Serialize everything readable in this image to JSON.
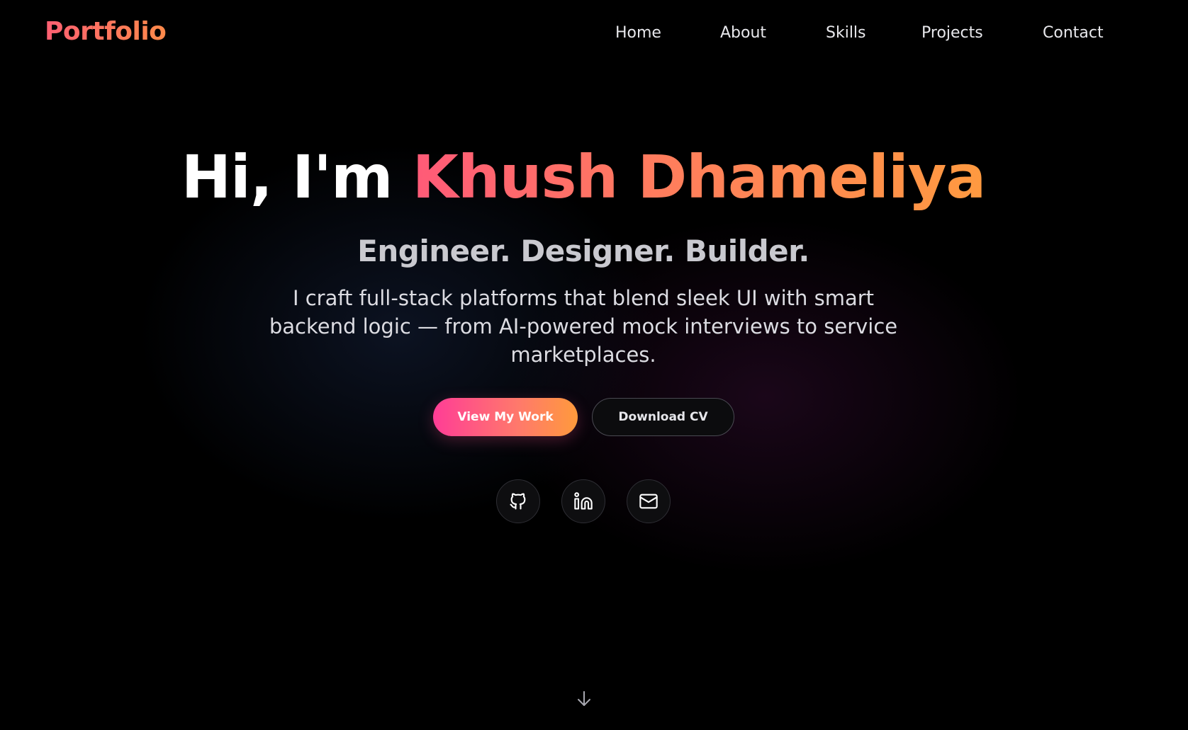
{
  "header": {
    "logo": "Portfolio",
    "nav": [
      "Home",
      "About",
      "Skills",
      "Projects",
      "Contact"
    ]
  },
  "hero": {
    "greeting": "Hi, I'm",
    "name": "Khush Dhameliya",
    "subtitle": "Engineer. Designer. Builder.",
    "description": "I craft full-stack platforms that blend sleek UI with smart backend logic — from AI-powered mock interviews to service marketplaces.",
    "primary_button": "View My Work",
    "secondary_button": "Download CV"
  },
  "social": {
    "icons": [
      "github-icon",
      "linkedin-icon",
      "mail-icon"
    ]
  },
  "scroll": {
    "icon": "arrow-down-icon"
  },
  "colors": {
    "background": "#000000",
    "accent_start": "#ff3d96",
    "accent_end": "#ff9a3c",
    "name_gradient_start": "#ff5a78",
    "name_gradient_end": "#ff9a40"
  }
}
